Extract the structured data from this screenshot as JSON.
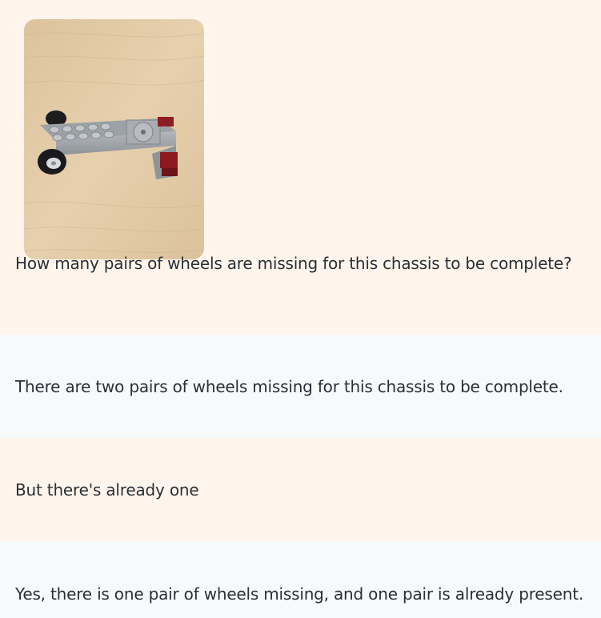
{
  "conversation": {
    "messages": [
      {
        "role": "user",
        "image": {
          "alt": "LEGO chassis with one pair of wheels"
        },
        "text": "How many pairs of wheels are missing for this chassis to be complete?"
      },
      {
        "role": "assistant",
        "text": "There are two pairs of wheels missing for this chassis to be complete."
      },
      {
        "role": "user",
        "text": "But there's already one"
      },
      {
        "role": "assistant",
        "text": "Yes, there is one pair of wheels missing, and one pair is already present."
      }
    ]
  },
  "colors": {
    "user_bg": "#fff5ec",
    "assistant_bg": "#f8f9fb",
    "text": "#2b2f36"
  }
}
